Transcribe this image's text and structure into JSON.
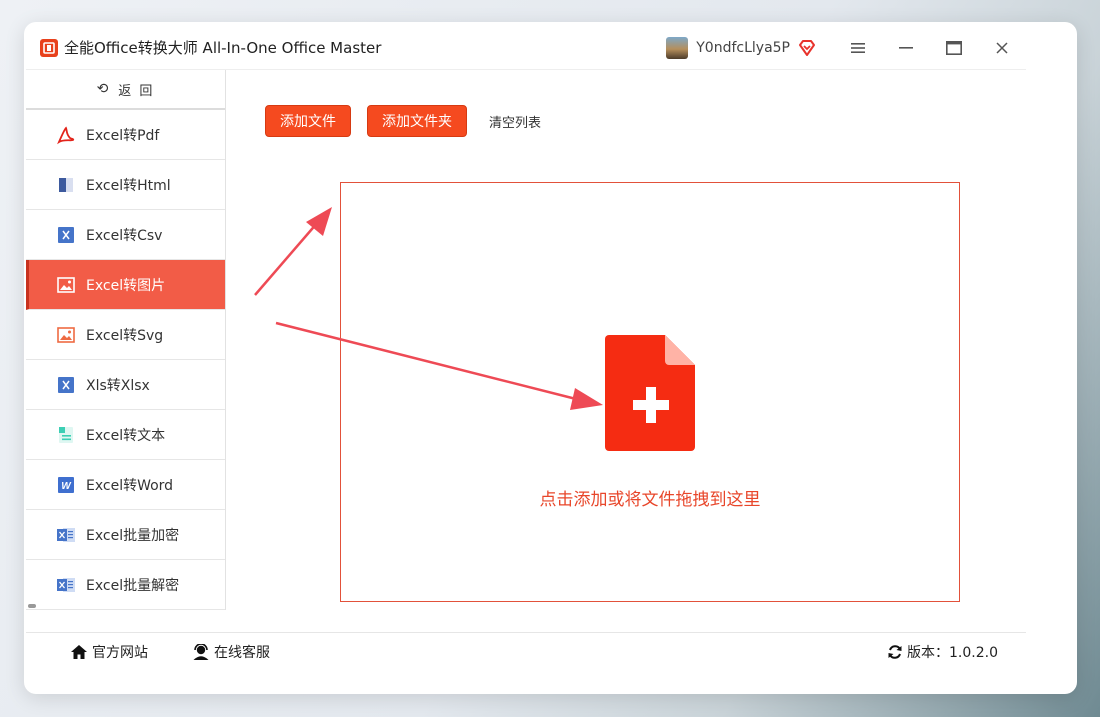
{
  "window": {
    "title": "全能Office转换大师 All-In-One Office Master",
    "logo_text": "ปี",
    "username": "Y0ndfcLlya5P"
  },
  "sidebar": {
    "back_label": "返 回",
    "items": [
      {
        "label": "Excel转Pdf",
        "icon": "pdf-icon"
      },
      {
        "label": "Excel转Html",
        "icon": "html-icon"
      },
      {
        "label": "Excel转Csv",
        "icon": "csv-icon"
      },
      {
        "label": "Excel转图片",
        "icon": "image-icon",
        "active": true
      },
      {
        "label": "Excel转Svg",
        "icon": "svg-image-icon"
      },
      {
        "label": "Xls转Xlsx",
        "icon": "xls-icon"
      },
      {
        "label": "Excel转文本",
        "icon": "text-doc-icon"
      },
      {
        "label": "Excel转Word",
        "icon": "word-icon"
      },
      {
        "label": "Excel批量加密",
        "icon": "excel-lock-icon"
      },
      {
        "label": "Excel批量解密",
        "icon": "excel-unlock-icon"
      }
    ]
  },
  "toolbar": {
    "add_file": "添加文件",
    "add_folder": "添加文件夹",
    "clear_list": "清空列表"
  },
  "dropzone": {
    "hint": "点击添加或将文件拖拽到这里"
  },
  "footer": {
    "website": "官方网站",
    "support": "在线客服",
    "version_label": "版本：1.0.2.0"
  },
  "colors": {
    "accent": "#f54a1f",
    "active_item": "#f25c47",
    "dropzone_border": "#e2513a",
    "arrow": "#ee4a55"
  }
}
